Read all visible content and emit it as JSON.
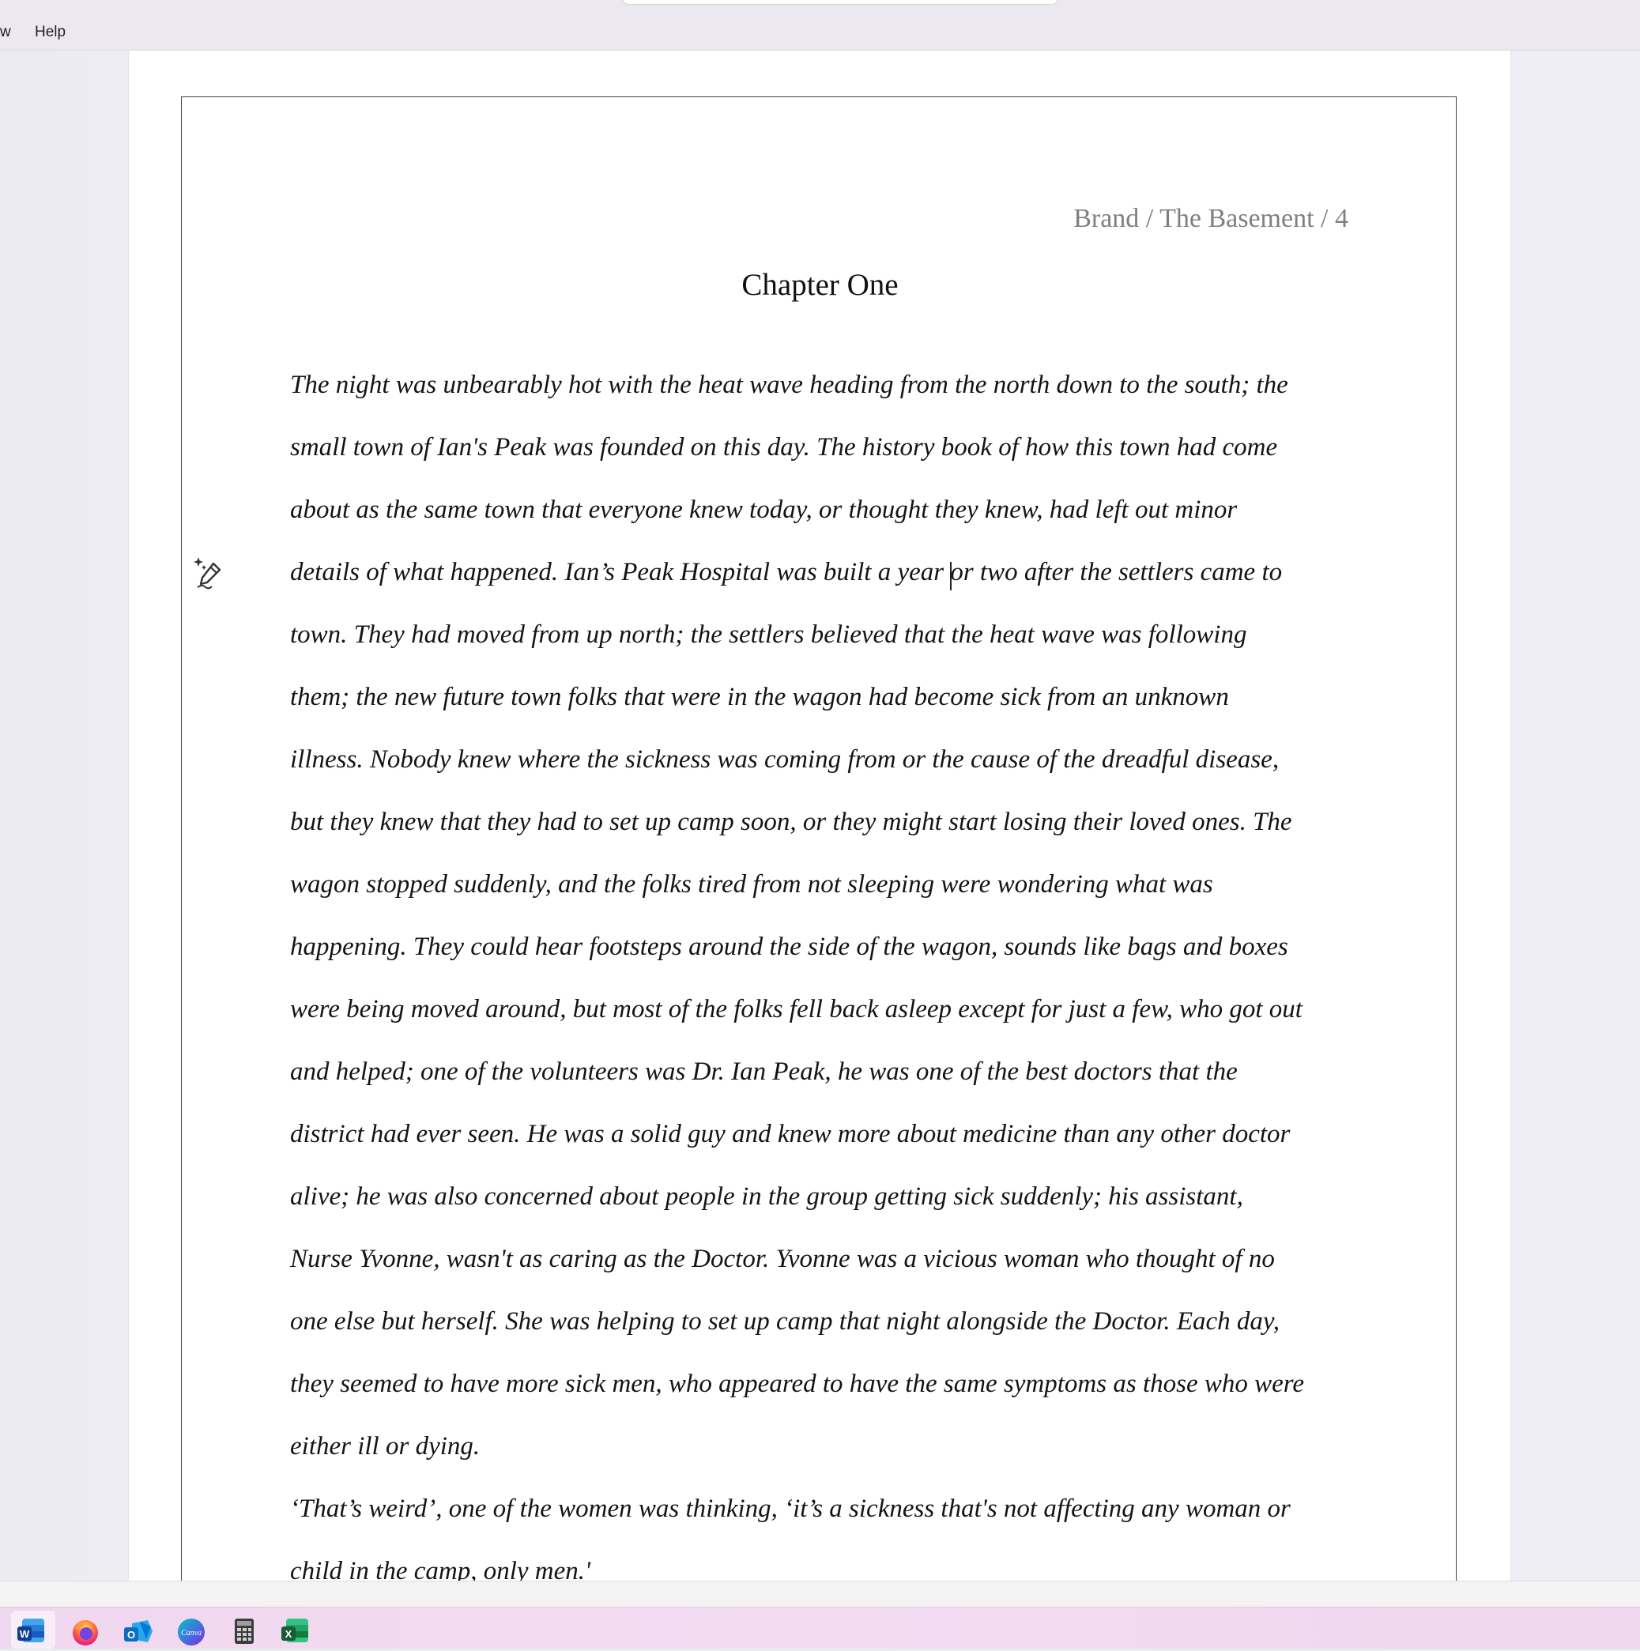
{
  "menu": {
    "view_partial": "w",
    "help": "Help"
  },
  "document": {
    "header": "Brand / The Basement / 4",
    "chapter_title": "Chapter One",
    "lines": [
      "The night was unbearably hot with the heat wave heading from the north down to the south; the",
      "small town of Ian's Peak was founded on this day. The history book of how this town had come",
      "about as the same town that everyone knew today, or thought they knew, had left out minor",
      "details of what happened. Ian’s Peak Hospital was built a year or two after the settlers came to",
      "town. They had moved from up north; the settlers believed that the heat wave was following",
      "them; the new future town folks that were in the wagon had become sick from an unknown",
      "illness. Nobody knew where the sickness was coming from or the cause of the dreadful disease,",
      "but they knew that they had to set up camp soon, or they might start losing their loved ones. The",
      "wagon stopped suddenly, and the folks tired from not sleeping were wondering what was",
      "happening. They could hear footsteps around the side of the wagon, sounds like bags and boxes",
      "were being moved around, but most of the folks fell back asleep except for just a few, who got out",
      "and helped; one of the volunteers was Dr. Ian Peak, he was one of the best doctors that the",
      "district had ever seen. He was a solid guy and knew more about medicine than any other doctor",
      "alive; he was also concerned about people in the group getting sick suddenly; his assistant,",
      "Nurse Yvonne, wasn't as caring as the Doctor. Yvonne was a vicious woman who thought of no",
      "one else but herself. She was helping to set up camp that night alongside the Doctor. Each day,",
      "they seemed to have more sick men, who appeared to have the same symptoms as those who were",
      "either ill or dying.",
      "‘That’s weird’, one of the women was thinking, ‘it’s a sickness that's not affecting any woman or",
      "child in the camp, only men.'"
    ]
  },
  "icons": {
    "margin_icon": "ai-rewrite-pen-icon",
    "taskbar": [
      "word-icon",
      "firefox-icon",
      "outlook-icon",
      "canva-icon",
      "calculator-icon",
      "excel-icon"
    ]
  },
  "taskbar_labels": {
    "word": "W",
    "outlook": "O",
    "canva": "Canva",
    "excel": "X"
  },
  "colors": {
    "word_blue": "#185abd",
    "excel_green": "#107c41",
    "outlook_blue": "#0f6cbd",
    "canva_teal": "#17b3c9",
    "firefox_orange": "#ff7139",
    "taskbar_pink": "#f2daf1"
  }
}
